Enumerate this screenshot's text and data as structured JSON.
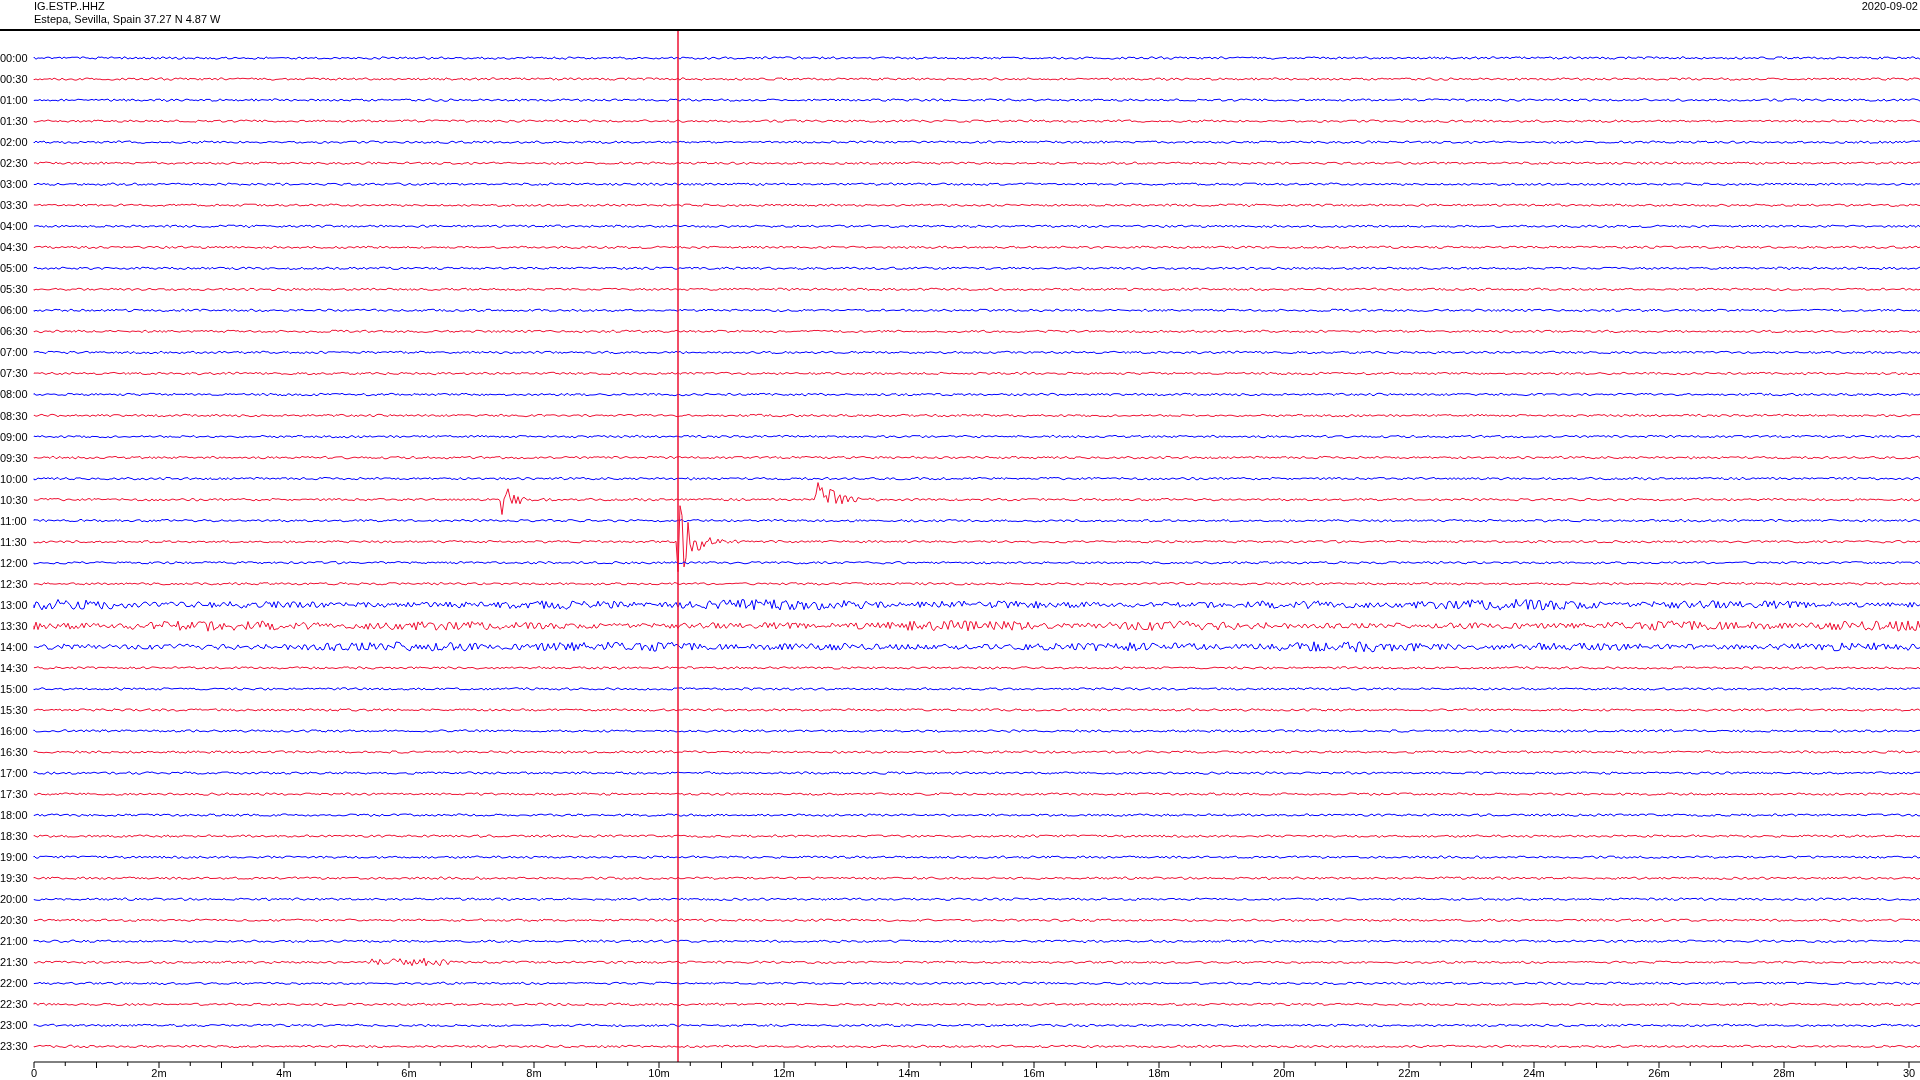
{
  "header": {
    "station": "IG.ESTP..HHZ",
    "location": "Estepa, Sevilla, Spain  37.27 N 4.87 W",
    "date": "2020-09-02"
  },
  "traces": [
    {
      "label": "00:00",
      "color": "#0000ff"
    },
    {
      "label": "00:30",
      "color": "#ee1133"
    },
    {
      "label": "01:00",
      "color": "#0000ff"
    },
    {
      "label": "01:30",
      "color": "#ee1133"
    },
    {
      "label": "02:00",
      "color": "#0000ff"
    },
    {
      "label": "02:30",
      "color": "#ee1133"
    },
    {
      "label": "03:00",
      "color": "#0000ff"
    },
    {
      "label": "03:30",
      "color": "#ee1133"
    },
    {
      "label": "04:00",
      "color": "#0000ff"
    },
    {
      "label": "04:30",
      "color": "#ee1133"
    },
    {
      "label": "05:00",
      "color": "#0000ff"
    },
    {
      "label": "05:30",
      "color": "#ee1133"
    },
    {
      "label": "06:00",
      "color": "#0000ff"
    },
    {
      "label": "06:30",
      "color": "#ee1133"
    },
    {
      "label": "07:00",
      "color": "#0000ff"
    },
    {
      "label": "07:30",
      "color": "#ee1133"
    },
    {
      "label": "08:00",
      "color": "#0000ff"
    },
    {
      "label": "08:30",
      "color": "#ee1133"
    },
    {
      "label": "09:00",
      "color": "#0000ff"
    },
    {
      "label": "09:30",
      "color": "#ee1133"
    },
    {
      "label": "10:00",
      "color": "#0000ff"
    },
    {
      "label": "10:30",
      "color": "#ee1133"
    },
    {
      "label": "11:00",
      "color": "#0000ff"
    },
    {
      "label": "11:30",
      "color": "#ee1133"
    },
    {
      "label": "12:00",
      "color": "#0000ff"
    },
    {
      "label": "12:30",
      "color": "#ee1133"
    },
    {
      "label": "13:00",
      "color": "#0000ff"
    },
    {
      "label": "13:30",
      "color": "#ee1133"
    },
    {
      "label": "14:00",
      "color": "#0000ff"
    },
    {
      "label": "14:30",
      "color": "#ee1133"
    },
    {
      "label": "15:00",
      "color": "#0000ff"
    },
    {
      "label": "15:30",
      "color": "#ee1133"
    },
    {
      "label": "16:00",
      "color": "#0000ff"
    },
    {
      "label": "16:30",
      "color": "#ee1133"
    },
    {
      "label": "17:00",
      "color": "#0000ff"
    },
    {
      "label": "17:30",
      "color": "#ee1133"
    },
    {
      "label": "18:00",
      "color": "#0000ff"
    },
    {
      "label": "18:30",
      "color": "#ee1133"
    },
    {
      "label": "19:00",
      "color": "#0000ff"
    },
    {
      "label": "19:30",
      "color": "#ee1133"
    },
    {
      "label": "20:00",
      "color": "#0000ff"
    },
    {
      "label": "20:30",
      "color": "#ee1133"
    },
    {
      "label": "21:00",
      "color": "#0000ff"
    },
    {
      "label": "21:30",
      "color": "#ee1133"
    },
    {
      "label": "22:00",
      "color": "#0000ff"
    },
    {
      "label": "22:30",
      "color": "#ee1133"
    },
    {
      "label": "23:00",
      "color": "#0000ff"
    },
    {
      "label": "23:30",
      "color": "#ee1133"
    }
  ],
  "axis": {
    "labels": [
      "0",
      "2m",
      "4m",
      "6m",
      "8m",
      "10m",
      "12m",
      "14m",
      "16m",
      "18m",
      "20m",
      "22m",
      "24m",
      "26m",
      "28m",
      "30"
    ]
  }
}
